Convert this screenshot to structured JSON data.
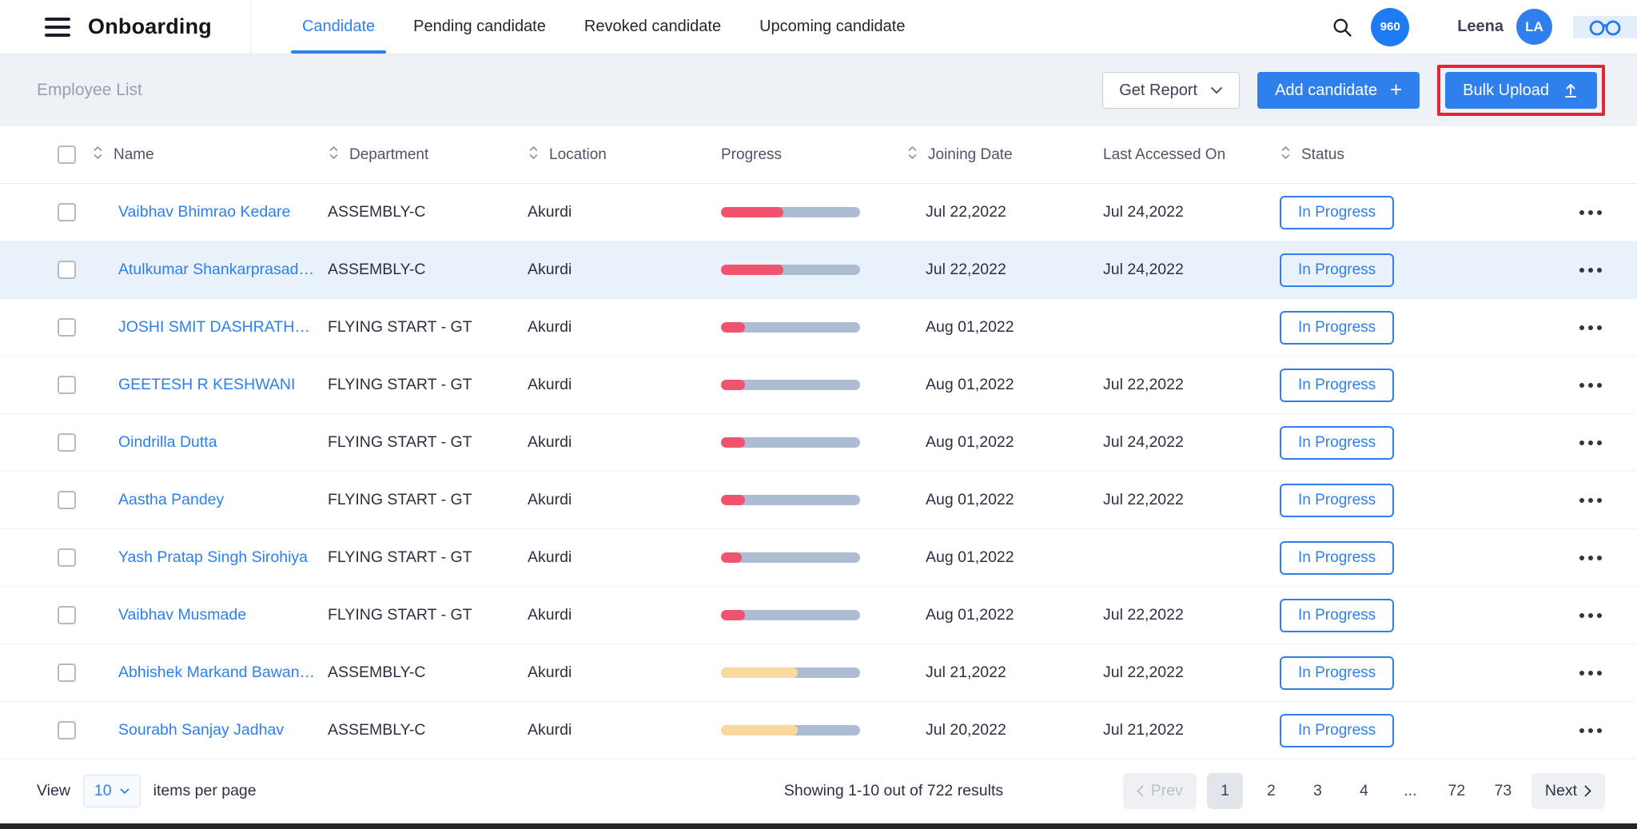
{
  "header": {
    "app_title": "Onboarding",
    "tabs": [
      {
        "label": "Candidate",
        "active": true
      },
      {
        "label": "Pending candidate",
        "active": false
      },
      {
        "label": "Revoked candidate",
        "active": false
      },
      {
        "label": "Upcoming candidate",
        "active": false
      }
    ],
    "notification_count": "960",
    "user_name": "Leena",
    "avatar_initials": "LA"
  },
  "toolbar": {
    "page_title": "Employee List",
    "get_report_label": "Get Report",
    "add_candidate_label": "Add candidate",
    "bulk_upload_label": "Bulk Upload"
  },
  "colors": {
    "accent_blue": "#2f80ed",
    "progress_track": "#aebcd2",
    "progress_red": "#f0536d",
    "progress_yellow": "#f8d9a2",
    "annotation_red": "#e42535"
  },
  "table": {
    "columns": [
      {
        "label": "Name",
        "sortable": true
      },
      {
        "label": "Department",
        "sortable": true
      },
      {
        "label": "Location",
        "sortable": true
      },
      {
        "label": "Progress",
        "sortable": false
      },
      {
        "label": "Joining Date",
        "sortable": true
      },
      {
        "label": "Last Accessed On",
        "sortable": false
      },
      {
        "label": "Status",
        "sortable": true
      }
    ],
    "rows": [
      {
        "name": "Vaibhav Bhimrao Kedare",
        "department": "ASSEMBLY-C",
        "location": "Akurdi",
        "progress_pct": 45,
        "progress_color": "#f0536d",
        "joining_date": "Jul 22,2022",
        "last_accessed_on": "Jul 24,2022",
        "status": "In Progress",
        "highlighted": false
      },
      {
        "name": "Atulkumar Shankarprasad M...",
        "department": "ASSEMBLY-C",
        "location": "Akurdi",
        "progress_pct": 45,
        "progress_color": "#f0536d",
        "joining_date": "Jul 22,2022",
        "last_accessed_on": "Jul 24,2022",
        "status": "In Progress",
        "highlighted": true
      },
      {
        "name": "JOSHI SMIT DASHRATHKUMAR",
        "department": "FLYING START - GT",
        "location": "Akurdi",
        "progress_pct": 17,
        "progress_color": "#f0536d",
        "joining_date": "Aug 01,2022",
        "last_accessed_on": "",
        "status": "In Progress",
        "highlighted": false
      },
      {
        "name": "GEETESH R KESHWANI",
        "department": "FLYING START - GT",
        "location": "Akurdi",
        "progress_pct": 17,
        "progress_color": "#f0536d",
        "joining_date": "Aug 01,2022",
        "last_accessed_on": "Jul 22,2022",
        "status": "In Progress",
        "highlighted": false
      },
      {
        "name": "Oindrilla Dutta",
        "department": "FLYING START - GT",
        "location": "Akurdi",
        "progress_pct": 17,
        "progress_color": "#f0536d",
        "joining_date": "Aug 01,2022",
        "last_accessed_on": "Jul 24,2022",
        "status": "In Progress",
        "highlighted": false
      },
      {
        "name": "Aastha Pandey",
        "department": "FLYING START - GT",
        "location": "Akurdi",
        "progress_pct": 17,
        "progress_color": "#f0536d",
        "joining_date": "Aug 01,2022",
        "last_accessed_on": "Jul 22,2022",
        "status": "In Progress",
        "highlighted": false
      },
      {
        "name": "Yash Pratap Singh Sirohiya",
        "department": "FLYING START - GT",
        "location": "Akurdi",
        "progress_pct": 15,
        "progress_color": "#f0536d",
        "joining_date": "Aug 01,2022",
        "last_accessed_on": "",
        "status": "In Progress",
        "highlighted": false
      },
      {
        "name": "Vaibhav Musmade",
        "department": "FLYING START - GT",
        "location": "Akurdi",
        "progress_pct": 17,
        "progress_color": "#f0536d",
        "joining_date": "Aug 01,2022",
        "last_accessed_on": "Jul 22,2022",
        "status": "In Progress",
        "highlighted": false
      },
      {
        "name": "Abhishek Markand Bawankar",
        "department": "ASSEMBLY-C",
        "location": "Akurdi",
        "progress_pct": 55,
        "progress_color": "#f8d9a2",
        "joining_date": "Jul 21,2022",
        "last_accessed_on": "Jul 22,2022",
        "status": "In Progress",
        "highlighted": false
      },
      {
        "name": "Sourabh Sanjay Jadhav",
        "department": "ASSEMBLY-C",
        "location": "Akurdi",
        "progress_pct": 55,
        "progress_color": "#f8d9a2",
        "joining_date": "Jul 20,2022",
        "last_accessed_on": "Jul 21,2022",
        "status": "In Progress",
        "highlighted": false
      }
    ]
  },
  "pagination": {
    "view_label": "View",
    "items_per_page": "10",
    "suffix_label": "items per page",
    "showing_text": "Showing 1-10 out of 722 results",
    "prev_label": "Prev",
    "next_label": "Next",
    "pages": [
      "1",
      "2",
      "3",
      "4",
      "...",
      "72",
      "73"
    ],
    "active_page": "1"
  }
}
